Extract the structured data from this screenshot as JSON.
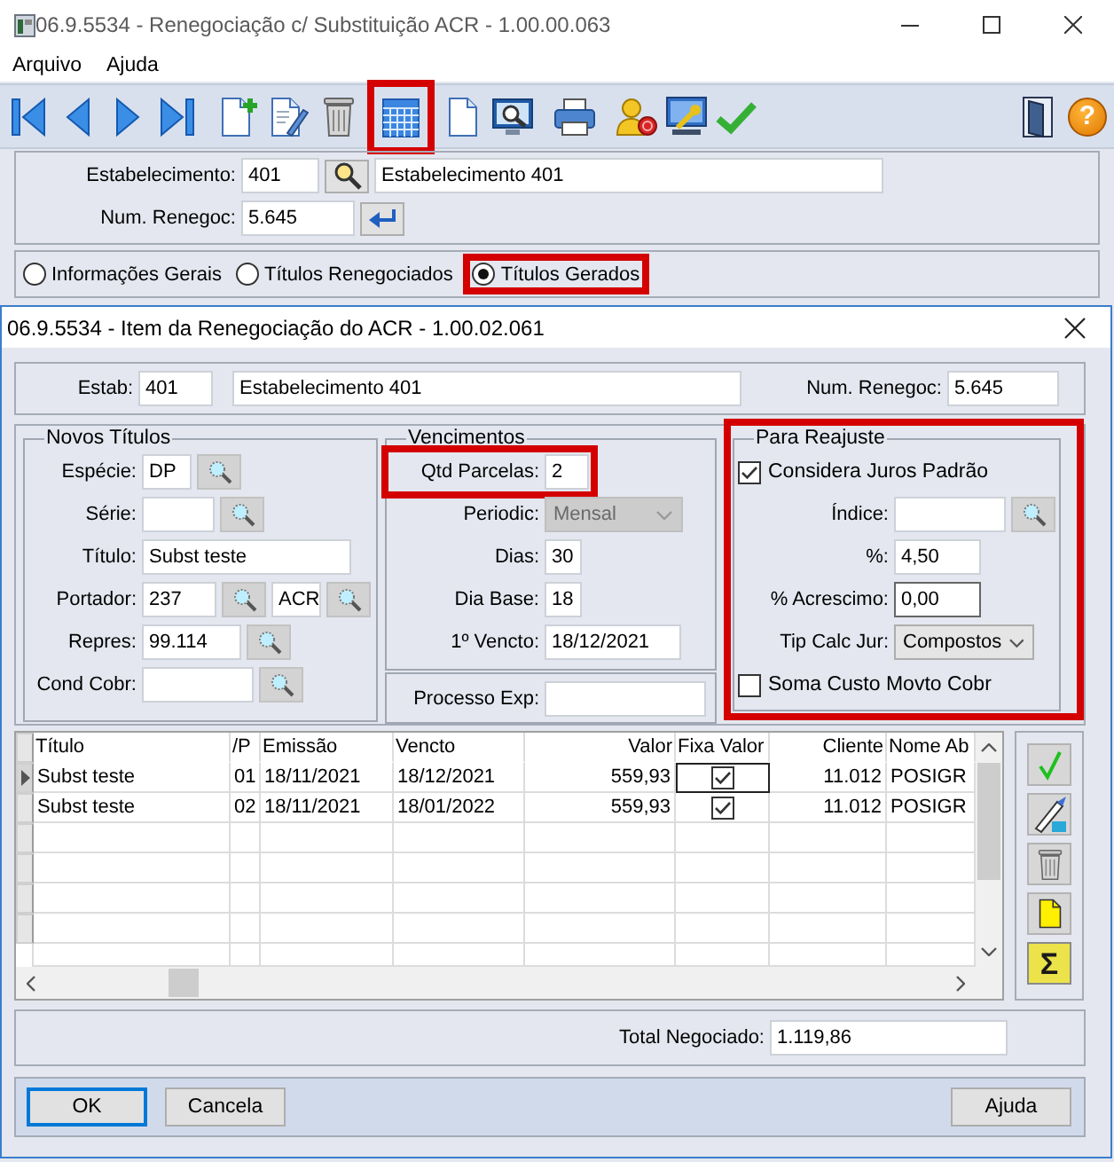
{
  "window": {
    "title": "06.9.5534 - Renegociação c/ Substituição ACR - 1.00.00.063",
    "menu": [
      "Arquivo",
      "Ajuda"
    ]
  },
  "toolbar": {
    "groups": [
      [
        {
          "kind": "first",
          "highlighted": false
        },
        {
          "kind": "previous",
          "highlighted": false
        },
        {
          "kind": "next",
          "highlighted": false
        },
        {
          "kind": "last",
          "highlighted": false
        }
      ],
      [
        {
          "kind": "new",
          "highlighted": false
        },
        {
          "kind": "edit",
          "highlighted": false
        },
        {
          "kind": "delete",
          "highlighted": false
        }
      ],
      [
        {
          "kind": "calendar",
          "highlighted": true
        }
      ],
      [
        {
          "kind": "document",
          "highlighted": false
        },
        {
          "kind": "preview",
          "highlighted": false
        }
      ],
      [
        {
          "kind": "print",
          "highlighted": false
        }
      ],
      [
        {
          "kind": "finance",
          "highlighted": false
        },
        {
          "kind": "settings",
          "highlighted": false
        },
        {
          "kind": "confirm",
          "highlighted": false
        }
      ]
    ],
    "end": [
      {
        "kind": "exit"
      },
      {
        "kind": "help",
        "symbol": "?"
      }
    ]
  },
  "header": {
    "rows": [
      {
        "label": "Estabelecimento:",
        "items": [
          {
            "kind": "field",
            "value": "401"
          },
          {
            "kind": "search"
          },
          {
            "kind": "field",
            "value": "Estabelecimento 401"
          }
        ]
      },
      {
        "label": "Num. Renegoc:",
        "items": [
          {
            "kind": "field",
            "value": "5.645"
          },
          {
            "kind": "enter"
          }
        ]
      }
    ]
  },
  "views": [
    {
      "label": "Informações Gerais",
      "selected": false,
      "highlighted": false
    },
    {
      "label": "Títulos Renegociados",
      "selected": false,
      "highlighted": false
    },
    {
      "label": "Títulos Gerados",
      "selected": true,
      "highlighted": true
    }
  ],
  "dialog": {
    "title": "06.9.5534 - Item da Renegociação do ACR - 1.00.02.061",
    "top": [
      {
        "label": "Estab:",
        "items": [
          {
            "kind": "field",
            "value": "401"
          },
          {
            "kind": "field",
            "value": "Estabelecimento 401"
          }
        ]
      },
      {
        "label": "Num. Renegoc:",
        "items": [
          {
            "kind": "field",
            "value": "5.645"
          }
        ]
      }
    ],
    "columns": [
      [
        {
          "kind": "group",
          "title": "Novos Títulos",
          "highlighted": false,
          "rows": [
            {
              "kind": "fields",
              "label": "Espécie:",
              "items": [
                {
                  "kind": "field",
                  "value": "DP"
                },
                {
                  "kind": "lookup"
                }
              ]
            },
            {
              "kind": "fields",
              "label": "Série:",
              "items": [
                {
                  "kind": "field"
                },
                {
                  "kind": "lookup"
                }
              ]
            },
            {
              "kind": "fields",
              "label": "Título:",
              "items": [
                {
                  "kind": "field",
                  "value": "Subst teste"
                }
              ]
            },
            {
              "kind": "fields",
              "label": "Portador:",
              "items": [
                {
                  "kind": "field",
                  "value": "237"
                },
                {
                  "kind": "lookup"
                },
                {
                  "kind": "field",
                  "value": "ACR"
                },
                {
                  "kind": "lookup"
                }
              ]
            },
            {
              "kind": "fields",
              "label": "Repres:",
              "items": [
                {
                  "kind": "field",
                  "value": "99.114"
                },
                {
                  "kind": "lookup"
                }
              ]
            },
            {
              "kind": "fields",
              "label": "Cond Cobr:",
              "items": [
                {
                  "kind": "field"
                },
                {
                  "kind": "lookup"
                }
              ]
            }
          ]
        }
      ],
      [
        {
          "kind": "group",
          "title": "Vencimentos",
          "highlighted": false,
          "rows": [
            {
              "kind": "fields",
              "label": "Qtd Parcelas:",
              "highlighted": true,
              "items": [
                {
                  "kind": "field",
                  "value": "2"
                }
              ]
            },
            {
              "kind": "fields",
              "label": "Periodic:",
              "highlighted": false,
              "items": [
                {
                  "kind": "select",
                  "value": "Mensal",
                  "disabled": true
                }
              ]
            },
            {
              "kind": "fields",
              "label": "Dias:",
              "highlighted": false,
              "items": [
                {
                  "kind": "field",
                  "value": "30"
                }
              ]
            },
            {
              "kind": "fields",
              "label": "Dia Base:",
              "highlighted": false,
              "items": [
                {
                  "kind": "field",
                  "value": "18"
                }
              ]
            },
            {
              "kind": "fields",
              "label": "1º Vencto:",
              "highlighted": false,
              "items": [
                {
                  "kind": "field",
                  "value": "18/12/2021"
                }
              ]
            }
          ]
        },
        {
          "kind": "panel",
          "rows": [
            {
              "kind": "fields",
              "label": "Processo Exp:",
              "items": [
                {
                  "kind": "field"
                }
              ]
            }
          ]
        }
      ],
      [
        {
          "kind": "group",
          "title": "Para Reajuste",
          "highlighted": true,
          "rows": [
            {
              "kind": "checkbox",
              "label": "Considera Juros Padrão",
              "checked": true
            },
            {
              "kind": "fields",
              "label": "Índice:",
              "items": [
                {
                  "kind": "field"
                },
                {
                  "kind": "lookup"
                }
              ]
            },
            {
              "kind": "fields",
              "label": "%:",
              "items": [
                {
                  "kind": "field",
                  "value": "4,50"
                }
              ]
            },
            {
              "kind": "fields",
              "label": "% Acrescimo:",
              "items": [
                {
                  "kind": "field",
                  "value": "0,00",
                  "focused": true
                }
              ]
            },
            {
              "kind": "fields",
              "label": "Tip Calc Jur:",
              "items": [
                {
                  "kind": "select",
                  "value": "Compostos",
                  "disabled": false
                }
              ]
            },
            {
              "kind": "checkbox",
              "label": "Soma Custo Movto Cobr",
              "checked": false
            }
          ]
        }
      ]
    ]
  },
  "grid": {
    "columns": [
      {
        "label": "Título",
        "kind": "text"
      },
      {
        "label": "/P",
        "kind": "text"
      },
      {
        "label": "Emissão",
        "kind": "text"
      },
      {
        "label": "Vencto",
        "kind": "text"
      },
      {
        "label": "Valor",
        "kind": "number"
      },
      {
        "label": "Fixa Valor",
        "kind": "check"
      },
      {
        "label": "Cliente",
        "kind": "number"
      },
      {
        "label": "Nome Ab",
        "kind": "text"
      }
    ],
    "rows": [
      {
        "current": true,
        "cells": [
          {
            "text": "Subst teste"
          },
          {
            "text": "01"
          },
          {
            "text": "18/11/2021"
          },
          {
            "text": "18/12/2021"
          },
          {
            "text": "559,93"
          },
          {
            "checked": true,
            "focused": true
          },
          {
            "text": "11.012"
          },
          {
            "text": "POSIGR"
          }
        ]
      },
      {
        "current": false,
        "cells": [
          {
            "text": "Subst teste"
          },
          {
            "text": "02"
          },
          {
            "text": "18/11/2021"
          },
          {
            "text": "18/01/2022"
          },
          {
            "text": "559,93"
          },
          {
            "checked": true,
            "focused": false
          },
          {
            "text": "11.012"
          },
          {
            "text": "POSIGR"
          }
        ]
      }
    ]
  },
  "grid_tools": [
    {
      "kind": "confirm"
    },
    {
      "kind": "edit"
    },
    {
      "kind": "delete"
    },
    {
      "kind": "new"
    },
    {
      "kind": "sum",
      "symbol": "Σ"
    }
  ],
  "total": {
    "label": "Total Negociado:",
    "value": "1.119,86"
  },
  "buttons": {
    "start": [
      {
        "label": "OK",
        "focused": true
      },
      {
        "label": "Cancela",
        "focused": false
      }
    ],
    "end": [
      {
        "label": "Ajuda",
        "focused": false
      }
    ]
  }
}
